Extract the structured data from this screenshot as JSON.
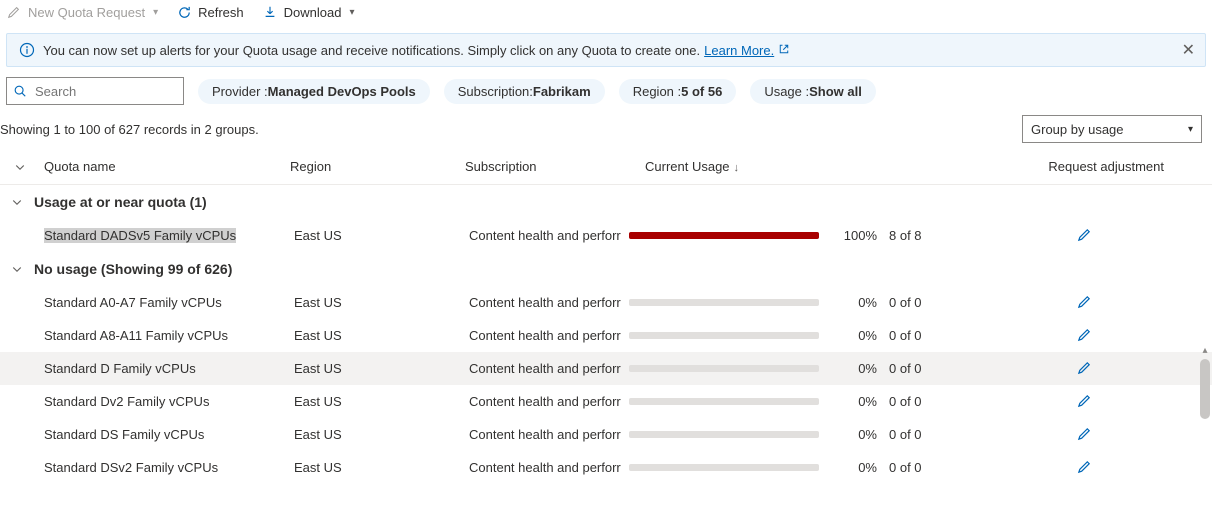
{
  "toolbar": {
    "new_quota": "New Quota Request",
    "refresh": "Refresh",
    "download": "Download"
  },
  "info": {
    "message": "You can now set up alerts for your Quota usage and receive notifications. Simply click on any Quota to create one.",
    "learn_more": "Learn More."
  },
  "search": {
    "placeholder": "Search"
  },
  "pills": {
    "provider_label": "Provider : ",
    "provider_value": "Managed DevOps Pools",
    "subscription_label": "Subscription: ",
    "subscription_value": "Fabrikam",
    "region_label": "Region : ",
    "region_value": "5 of 56",
    "usage_label": "Usage : ",
    "usage_value": "Show all"
  },
  "records_text": "Showing 1 to 100 of 627 records in 2 groups.",
  "group_by": "Group by usage",
  "columns": {
    "name": "Quota name",
    "region": "Region",
    "subscription": "Subscription",
    "usage": "Current Usage",
    "adjust": "Request adjustment"
  },
  "groups": [
    {
      "title": "Usage at or near quota (1)"
    },
    {
      "title": "No usage (Showing 99 of 626)"
    }
  ],
  "rows_g1": [
    {
      "name": "Standard DADSv5 Family vCPUs",
      "region": "East US",
      "sub": "Content health and perforr",
      "pct": "100%",
      "ofn": "8 of 8",
      "fill": 100,
      "hl": true
    }
  ],
  "rows_g2": [
    {
      "name": "Standard A0-A7 Family vCPUs",
      "region": "East US",
      "sub": "Content health and perforr",
      "pct": "0%",
      "ofn": "0 of 0",
      "fill": 0
    },
    {
      "name": "Standard A8-A11 Family vCPUs",
      "region": "East US",
      "sub": "Content health and perforr",
      "pct": "0%",
      "ofn": "0 of 0",
      "fill": 0
    },
    {
      "name": "Standard D Family vCPUs",
      "region": "East US",
      "sub": "Content health and perforr",
      "pct": "0%",
      "ofn": "0 of 0",
      "fill": 0,
      "sel": true
    },
    {
      "name": "Standard Dv2 Family vCPUs",
      "region": "East US",
      "sub": "Content health and perforr",
      "pct": "0%",
      "ofn": "0 of 0",
      "fill": 0
    },
    {
      "name": "Standard DS Family vCPUs",
      "region": "East US",
      "sub": "Content health and perforr",
      "pct": "0%",
      "ofn": "0 of 0",
      "fill": 0
    },
    {
      "name": "Standard DSv2 Family vCPUs",
      "region": "East US",
      "sub": "Content health and perforr",
      "pct": "0%",
      "ofn": "0 of 0",
      "fill": 0
    }
  ]
}
